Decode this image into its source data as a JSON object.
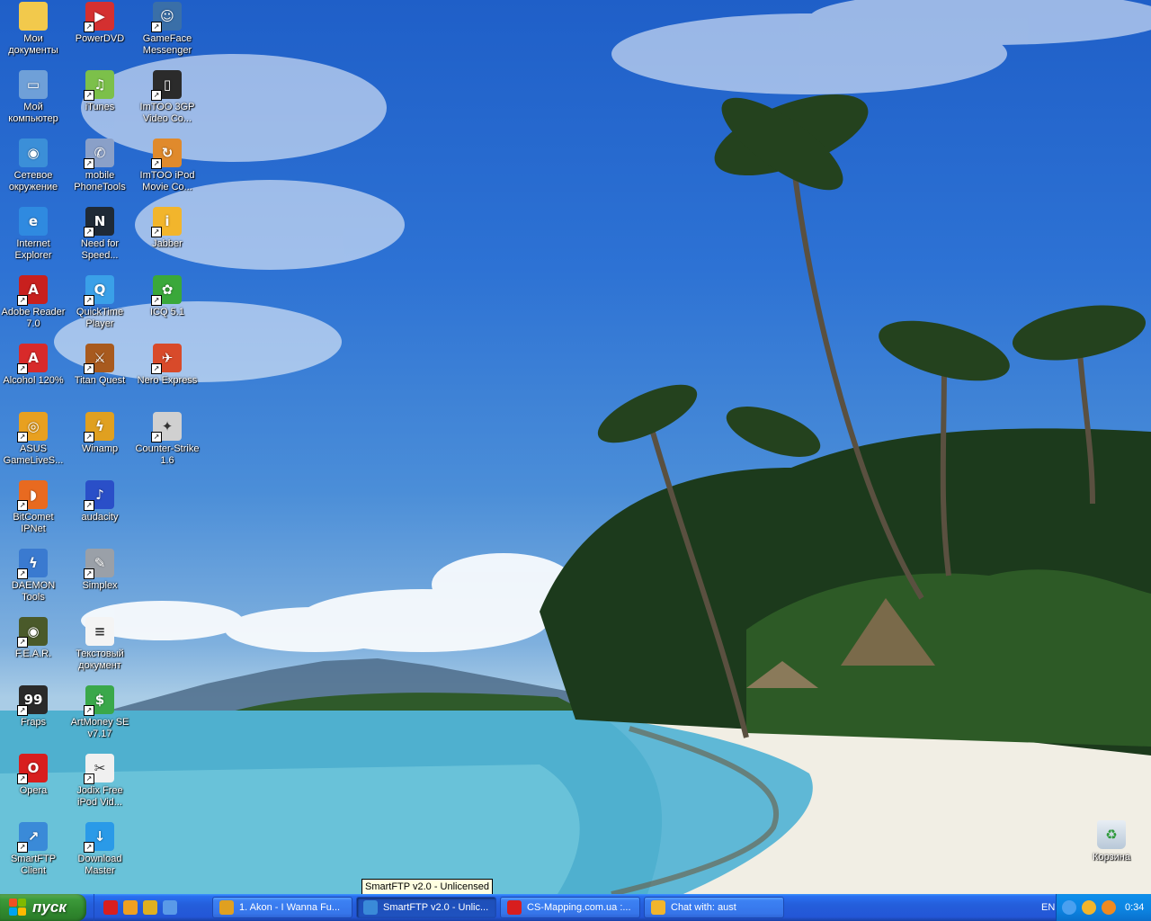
{
  "desktop": {
    "icons": [
      {
        "label": "Мои документы",
        "icon": "folder-documents-icon",
        "color": "#f2c94c",
        "glyph": "",
        "shortcut": false
      },
      {
        "label": "PowerDVD",
        "icon": "powerdvd-icon",
        "color": "#d43030",
        "glyph": "▶",
        "shortcut": true
      },
      {
        "label": "GameFace Messenger",
        "icon": "gameface-icon",
        "color": "#3a6fa8",
        "glyph": "☺",
        "shortcut": true
      },
      {
        "label": "Мой компьютер",
        "icon": "my-computer-icon",
        "color": "#6fa0d8",
        "glyph": "▭",
        "shortcut": false
      },
      {
        "label": "iTunes",
        "icon": "itunes-icon",
        "color": "#7cc04a",
        "glyph": "♫",
        "shortcut": true
      },
      {
        "label": "ImTOO 3GP Video Co...",
        "icon": "imtoo-3gp-icon",
        "color": "#2b2b2b",
        "glyph": "▯",
        "shortcut": true
      },
      {
        "label": "Сетевое окружение",
        "icon": "network-places-icon",
        "color": "#3b8fd8",
        "glyph": "◉",
        "shortcut": false
      },
      {
        "label": "mobile PhoneTools",
        "icon": "phonetools-icon",
        "color": "#8aa0c8",
        "glyph": "✆",
        "shortcut": true
      },
      {
        "label": "ImTOO iPod Movie Co...",
        "icon": "imtoo-ipod-icon",
        "color": "#e08a2c",
        "glyph": "↻",
        "shortcut": true
      },
      {
        "label": "Internet Explorer",
        "icon": "internet-explorer-icon",
        "color": "#2f8ae0",
        "glyph": "e",
        "shortcut": false
      },
      {
        "label": "Need for Speed...",
        "icon": "nfs-icon",
        "color": "#1f2a36",
        "glyph": "N",
        "shortcut": true
      },
      {
        "label": "Jabber",
        "icon": "jabber-icon",
        "color": "#f2b52c",
        "glyph": "i",
        "shortcut": true
      },
      {
        "label": "Adobe Reader 7.0",
        "icon": "adobe-reader-icon",
        "color": "#c8201e",
        "glyph": "A",
        "shortcut": true
      },
      {
        "label": "QuickTime Player",
        "icon": "quicktime-icon",
        "color": "#3aa0e8",
        "glyph": "Q",
        "shortcut": true
      },
      {
        "label": "ICQ 5.1",
        "icon": "icq-icon",
        "color": "#3aa83a",
        "glyph": "✿",
        "shortcut": true
      },
      {
        "label": "Alcohol 120%",
        "icon": "alcohol-icon",
        "color": "#d82a2a",
        "glyph": "A",
        "shortcut": true
      },
      {
        "label": "Titan Quest",
        "icon": "titan-quest-icon",
        "color": "#a85a1e",
        "glyph": "⚔",
        "shortcut": true
      },
      {
        "label": "Nero Express",
        "icon": "nero-icon",
        "color": "#d84a2a",
        "glyph": "✈",
        "shortcut": true
      },
      {
        "label": "ASUS GameLiveS...",
        "icon": "asus-gamelive-icon",
        "color": "#e8a020",
        "glyph": "◎",
        "shortcut": true
      },
      {
        "label": "Winamp",
        "icon": "winamp-icon",
        "color": "#e0a020",
        "glyph": "ϟ",
        "shortcut": true
      },
      {
        "label": "Counter-Strike 1.6",
        "icon": "counter-strike-icon",
        "color": "#d0d0d0",
        "glyph": "✦",
        "shortcut": true
      },
      {
        "label": "BitComet IPNet",
        "icon": "bitcomet-icon",
        "color": "#e86a20",
        "glyph": "◗",
        "shortcut": true
      },
      {
        "label": "audacity",
        "icon": "audacity-icon",
        "color": "#2a4fc8",
        "glyph": "♪",
        "shortcut": true
      },
      {
        "label": "DAEMON Tools",
        "icon": "daemon-tools-icon",
        "color": "#3a7ad0",
        "glyph": "ϟ",
        "shortcut": true
      },
      {
        "label": "Simplex",
        "icon": "wrench-icon",
        "color": "#9aa0a8",
        "glyph": "✎",
        "shortcut": true
      },
      {
        "label": "F.E.A.R.",
        "icon": "fear-icon",
        "color": "#4a5a2a",
        "glyph": "◉",
        "shortcut": true
      },
      {
        "label": "Текстовый документ",
        "icon": "text-document-icon",
        "color": "#f4f4f4",
        "glyph": "≡",
        "shortcut": false
      },
      {
        "label": "Fraps",
        "icon": "fraps-icon",
        "color": "#2a2a2a",
        "glyph": "99",
        "shortcut": true
      },
      {
        "label": "ArtMoney SE v7.17",
        "icon": "artmoney-icon",
        "color": "#3aa84a",
        "glyph": "$",
        "shortcut": true
      },
      {
        "label": "Opera",
        "icon": "opera-icon",
        "color": "#d81e1e",
        "glyph": "O",
        "shortcut": true
      },
      {
        "label": "Jodix Free iPod Vid...",
        "icon": "jodix-icon",
        "color": "#f0f0f0",
        "glyph": "✂",
        "shortcut": true
      },
      {
        "label": "SmartFTP Client",
        "icon": "smartftp-icon",
        "color": "#3a8ad8",
        "glyph": "↗",
        "shortcut": true
      },
      {
        "label": "Download Master",
        "icon": "download-master-icon",
        "color": "#2a9ae8",
        "glyph": "↓",
        "shortcut": true
      }
    ],
    "recycle_bin": {
      "label": "Корзина",
      "icon": "recycle-bin-icon"
    }
  },
  "tooltip": {
    "text": "SmartFTP v2.0 - Unlicensed"
  },
  "taskbar": {
    "start_label": "пуск",
    "quick_launch": [
      {
        "icon": "opera-quicklaunch-icon",
        "color": "#d81e1e"
      },
      {
        "icon": "media-player-quicklaunch-icon",
        "color": "#f0a020"
      },
      {
        "icon": "winamp-quicklaunch-icon",
        "color": "#e0b020"
      },
      {
        "icon": "show-desktop-quicklaunch-icon",
        "color": "#5a9ae8"
      }
    ],
    "tasks": [
      {
        "label": "1. Akon - I Wanna Fu...",
        "icon": "winamp-task-icon",
        "color": "#e0a020",
        "active": false
      },
      {
        "label": "SmartFTP v2.0 - Unlic...",
        "icon": "smartftp-task-icon",
        "color": "#3a8ad8",
        "active": true
      },
      {
        "label": "CS-Mapping.com.ua :...",
        "icon": "opera-task-icon",
        "color": "#d81e1e",
        "active": false
      },
      {
        "label": "Chat with: aust",
        "icon": "jabber-task-icon",
        "color": "#f2b52c",
        "active": false
      }
    ],
    "language": "EN",
    "tray_icons": [
      {
        "icon": "tray-arrow-icon",
        "color": "#4aa0f0"
      },
      {
        "icon": "tray-jabber-icon",
        "color": "#f2b52c"
      },
      {
        "icon": "tray-media-icon",
        "color": "#f08a20"
      }
    ],
    "clock": "0:34"
  }
}
